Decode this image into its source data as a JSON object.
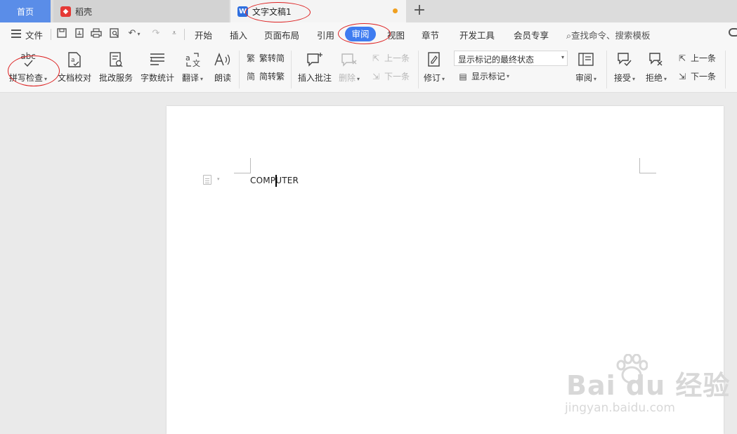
{
  "tabs": {
    "home": "首页",
    "daoke": "稻壳",
    "doc": "文字文稿1",
    "doc_logo": "W"
  },
  "menu": {
    "file": "文件",
    "items": [
      "开始",
      "插入",
      "页面布局",
      "引用",
      "审阅",
      "视图",
      "章节",
      "开发工具",
      "会员专享"
    ],
    "active": "审阅",
    "search": "查找命令、搜索模板"
  },
  "ribbon": {
    "spell_check": "拼写检查",
    "doc_proof": "文档校对",
    "review_service": "批改服务",
    "word_count": "字数统计",
    "translate": "翻译",
    "read_aloud": "朗读",
    "trad_to_simp": "繁转简",
    "simp_to_trad": "简转繁",
    "insert_comment": "插入批注",
    "delete": "删除",
    "prev_comment": "上一条",
    "next_comment": "下一条",
    "track_changes": "修订",
    "markup_state": "显示标记的最终状态",
    "show_markup": "显示标记",
    "review": "审阅",
    "accept": "接受",
    "reject": "拒绝",
    "prev_change": "上一条",
    "next_change": "下一条",
    "abc": "abc"
  },
  "document": {
    "text": "COMPUTER"
  },
  "watermark": {
    "main": "Bai du 经验",
    "sub": "jingyan.baidu.com"
  },
  "colors": {
    "accent": "#3f7cf0",
    "home_tab": "#5a8de8",
    "annotation": "#dd2222",
    "unsaved": "#f0a020"
  }
}
